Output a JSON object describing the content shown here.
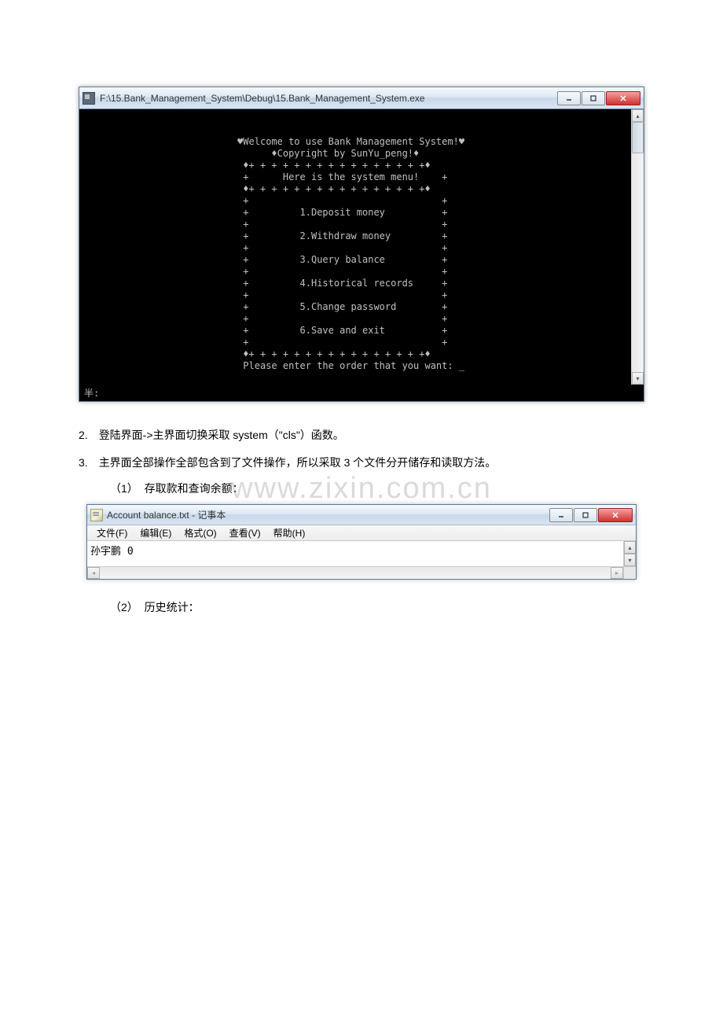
{
  "console": {
    "title": "F:\\15.Bank_Management_System\\Debug\\15.Bank_Management_System.exe",
    "lines": [
      "",
      "",
      "                           ♥Welcome to use Bank Management System!♥",
      "                                 ♦Copyright by SunYu_peng!♦",
      "                            ♦+ + + + + + + + + + + + + + + +♦",
      "                            +      Here is the system menu!    +",
      "                            ♦+ + + + + + + + + + + + + + + +♦",
      "                            +                                  +",
      "                            +         1.Deposit money          +",
      "                            +                                  +",
      "                            +         2.Withdraw money         +",
      "                            +                                  +",
      "                            +         3.Query balance          +",
      "                            +                                  +",
      "                            +         4.Historical records     +",
      "                            +                                  +",
      "                            +         5.Change password        +",
      "                            +                                  +",
      "                            +         6.Save and exit          +",
      "                            +                                  +",
      "                            ♦+ + + + + + + + + + + + + + + +♦",
      "                            Please enter the order that you want: _"
    ],
    "status": "半:"
  },
  "doc": {
    "line2_num": "2.",
    "line2_text": "登陆界面->主界面切换采取 system（\"cls\"）函数。",
    "line3_num": "3.",
    "line3_text": "主界面全部操作全部包含到了文件操作，所以采取 3 个文件分开储存和读取方法。",
    "sub1_num": "（1）",
    "sub1_text": "存取款和查询余额：",
    "sub2_num": "（2）",
    "sub2_text": "历史统计："
  },
  "watermark": "www.zixin.com.cn",
  "notepad": {
    "title": "Account balance.txt - 记事本",
    "menus": [
      "文件(F)",
      "编辑(E)",
      "格式(O)",
      "查看(V)",
      "帮助(H)"
    ],
    "content": "孙宇鹏   0"
  }
}
